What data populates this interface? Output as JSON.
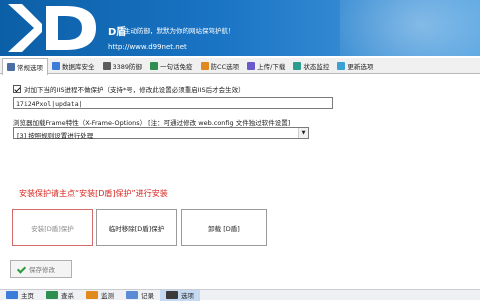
{
  "banner": {
    "logo_text": "D",
    "brand": "D盾",
    "slogan": "主动防御，默默为你的网站保驾护航！",
    "url": "http://www.d99net.net"
  },
  "tabs": [
    {
      "label": "常规选项",
      "icon": "wrench-icon",
      "color": "#4a6fa5",
      "active": true
    },
    {
      "label": "数据库安全",
      "icon": "database-icon",
      "color": "#3b7dd8",
      "active": false
    },
    {
      "label": "3389防御",
      "icon": "monitor-icon",
      "color": "#5b5b5b",
      "active": false
    },
    {
      "label": "一句话免疫",
      "icon": "shield-icon",
      "color": "#2f8f4e",
      "active": false
    },
    {
      "label": "防CC选项",
      "icon": "cc-icon",
      "color": "#e08a1e",
      "active": false
    },
    {
      "label": "上传/下载",
      "icon": "transfer-icon",
      "color": "#6a5acd",
      "active": false
    },
    {
      "label": "状态监控",
      "icon": "monitor-icon",
      "color": "#2a9d8f",
      "active": false
    },
    {
      "label": "更新选项",
      "icon": "update-icon",
      "color": "#3aa0d6",
      "active": false
    }
  ],
  "options": {
    "iis_checkbox_label": "对加下当的IIS进程不做保护（支持*号，修改此设置必须重启IIS后才会生效）",
    "iis_checked": true,
    "iis_input_value": "17i24Pxol|updata|",
    "frame_desc": "浏览器加载Frame特性（X-Frame-Options）  [注：可通过修改 web.config 文件独过软件设置]",
    "frame_select_value": "[3] 按照规则设置进行处理"
  },
  "install": {
    "hint": "安装保护请主点“安装[D盾]保护”进行安装",
    "btn_install": "安装[D盾]保护",
    "btn_temp_remove": "临时移除[D盾]保护",
    "btn_uninstall": "卸载 [D盾]"
  },
  "save_label": "保存修改",
  "bottom": [
    {
      "label": "主页",
      "icon": "home-icon",
      "color": "#3b7dd8",
      "active": false
    },
    {
      "label": "查杀",
      "icon": "scan-icon",
      "color": "#2f8f4e",
      "active": false
    },
    {
      "label": "监测",
      "icon": "monitor-icon",
      "color": "#e08a1e",
      "active": false
    },
    {
      "label": "记录",
      "icon": "log-icon",
      "color": "#5b8bd6",
      "active": false
    },
    {
      "label": "选项",
      "icon": "options-icon",
      "color": "#3a3a3a",
      "active": true
    }
  ]
}
